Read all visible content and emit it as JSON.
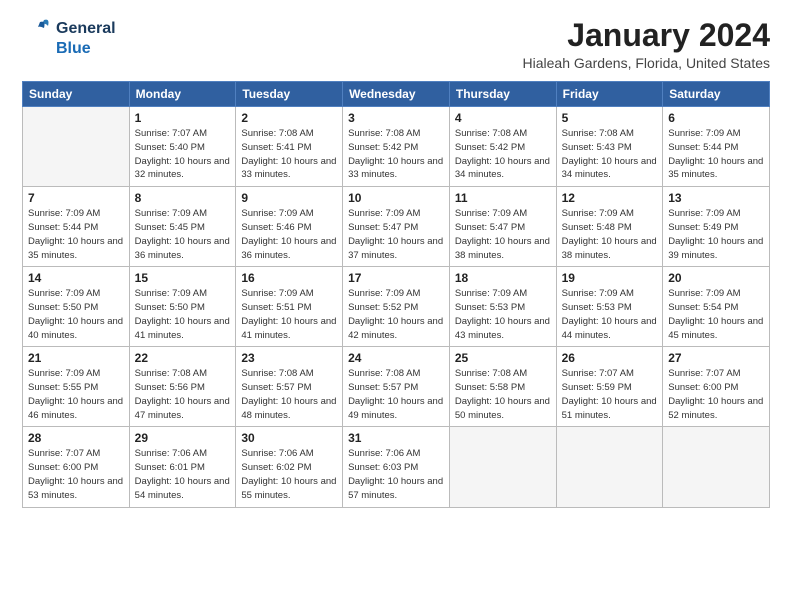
{
  "logo": {
    "line1": "General",
    "line2": "Blue"
  },
  "title": "January 2024",
  "subtitle": "Hialeah Gardens, Florida, United States",
  "days_of_week": [
    "Sunday",
    "Monday",
    "Tuesday",
    "Wednesday",
    "Thursday",
    "Friday",
    "Saturday"
  ],
  "weeks": [
    [
      {
        "num": "",
        "sunrise": "",
        "sunset": "",
        "daylight": ""
      },
      {
        "num": "1",
        "sunrise": "Sunrise: 7:07 AM",
        "sunset": "Sunset: 5:40 PM",
        "daylight": "Daylight: 10 hours and 32 minutes."
      },
      {
        "num": "2",
        "sunrise": "Sunrise: 7:08 AM",
        "sunset": "Sunset: 5:41 PM",
        "daylight": "Daylight: 10 hours and 33 minutes."
      },
      {
        "num": "3",
        "sunrise": "Sunrise: 7:08 AM",
        "sunset": "Sunset: 5:42 PM",
        "daylight": "Daylight: 10 hours and 33 minutes."
      },
      {
        "num": "4",
        "sunrise": "Sunrise: 7:08 AM",
        "sunset": "Sunset: 5:42 PM",
        "daylight": "Daylight: 10 hours and 34 minutes."
      },
      {
        "num": "5",
        "sunrise": "Sunrise: 7:08 AM",
        "sunset": "Sunset: 5:43 PM",
        "daylight": "Daylight: 10 hours and 34 minutes."
      },
      {
        "num": "6",
        "sunrise": "Sunrise: 7:09 AM",
        "sunset": "Sunset: 5:44 PM",
        "daylight": "Daylight: 10 hours and 35 minutes."
      }
    ],
    [
      {
        "num": "7",
        "sunrise": "Sunrise: 7:09 AM",
        "sunset": "Sunset: 5:44 PM",
        "daylight": "Daylight: 10 hours and 35 minutes."
      },
      {
        "num": "8",
        "sunrise": "Sunrise: 7:09 AM",
        "sunset": "Sunset: 5:45 PM",
        "daylight": "Daylight: 10 hours and 36 minutes."
      },
      {
        "num": "9",
        "sunrise": "Sunrise: 7:09 AM",
        "sunset": "Sunset: 5:46 PM",
        "daylight": "Daylight: 10 hours and 36 minutes."
      },
      {
        "num": "10",
        "sunrise": "Sunrise: 7:09 AM",
        "sunset": "Sunset: 5:47 PM",
        "daylight": "Daylight: 10 hours and 37 minutes."
      },
      {
        "num": "11",
        "sunrise": "Sunrise: 7:09 AM",
        "sunset": "Sunset: 5:47 PM",
        "daylight": "Daylight: 10 hours and 38 minutes."
      },
      {
        "num": "12",
        "sunrise": "Sunrise: 7:09 AM",
        "sunset": "Sunset: 5:48 PM",
        "daylight": "Daylight: 10 hours and 38 minutes."
      },
      {
        "num": "13",
        "sunrise": "Sunrise: 7:09 AM",
        "sunset": "Sunset: 5:49 PM",
        "daylight": "Daylight: 10 hours and 39 minutes."
      }
    ],
    [
      {
        "num": "14",
        "sunrise": "Sunrise: 7:09 AM",
        "sunset": "Sunset: 5:50 PM",
        "daylight": "Daylight: 10 hours and 40 minutes."
      },
      {
        "num": "15",
        "sunrise": "Sunrise: 7:09 AM",
        "sunset": "Sunset: 5:50 PM",
        "daylight": "Daylight: 10 hours and 41 minutes."
      },
      {
        "num": "16",
        "sunrise": "Sunrise: 7:09 AM",
        "sunset": "Sunset: 5:51 PM",
        "daylight": "Daylight: 10 hours and 41 minutes."
      },
      {
        "num": "17",
        "sunrise": "Sunrise: 7:09 AM",
        "sunset": "Sunset: 5:52 PM",
        "daylight": "Daylight: 10 hours and 42 minutes."
      },
      {
        "num": "18",
        "sunrise": "Sunrise: 7:09 AM",
        "sunset": "Sunset: 5:53 PM",
        "daylight": "Daylight: 10 hours and 43 minutes."
      },
      {
        "num": "19",
        "sunrise": "Sunrise: 7:09 AM",
        "sunset": "Sunset: 5:53 PM",
        "daylight": "Daylight: 10 hours and 44 minutes."
      },
      {
        "num": "20",
        "sunrise": "Sunrise: 7:09 AM",
        "sunset": "Sunset: 5:54 PM",
        "daylight": "Daylight: 10 hours and 45 minutes."
      }
    ],
    [
      {
        "num": "21",
        "sunrise": "Sunrise: 7:09 AM",
        "sunset": "Sunset: 5:55 PM",
        "daylight": "Daylight: 10 hours and 46 minutes."
      },
      {
        "num": "22",
        "sunrise": "Sunrise: 7:08 AM",
        "sunset": "Sunset: 5:56 PM",
        "daylight": "Daylight: 10 hours and 47 minutes."
      },
      {
        "num": "23",
        "sunrise": "Sunrise: 7:08 AM",
        "sunset": "Sunset: 5:57 PM",
        "daylight": "Daylight: 10 hours and 48 minutes."
      },
      {
        "num": "24",
        "sunrise": "Sunrise: 7:08 AM",
        "sunset": "Sunset: 5:57 PM",
        "daylight": "Daylight: 10 hours and 49 minutes."
      },
      {
        "num": "25",
        "sunrise": "Sunrise: 7:08 AM",
        "sunset": "Sunset: 5:58 PM",
        "daylight": "Daylight: 10 hours and 50 minutes."
      },
      {
        "num": "26",
        "sunrise": "Sunrise: 7:07 AM",
        "sunset": "Sunset: 5:59 PM",
        "daylight": "Daylight: 10 hours and 51 minutes."
      },
      {
        "num": "27",
        "sunrise": "Sunrise: 7:07 AM",
        "sunset": "Sunset: 6:00 PM",
        "daylight": "Daylight: 10 hours and 52 minutes."
      }
    ],
    [
      {
        "num": "28",
        "sunrise": "Sunrise: 7:07 AM",
        "sunset": "Sunset: 6:00 PM",
        "daylight": "Daylight: 10 hours and 53 minutes."
      },
      {
        "num": "29",
        "sunrise": "Sunrise: 7:06 AM",
        "sunset": "Sunset: 6:01 PM",
        "daylight": "Daylight: 10 hours and 54 minutes."
      },
      {
        "num": "30",
        "sunrise": "Sunrise: 7:06 AM",
        "sunset": "Sunset: 6:02 PM",
        "daylight": "Daylight: 10 hours and 55 minutes."
      },
      {
        "num": "31",
        "sunrise": "Sunrise: 7:06 AM",
        "sunset": "Sunset: 6:03 PM",
        "daylight": "Daylight: 10 hours and 57 minutes."
      },
      {
        "num": "",
        "sunrise": "",
        "sunset": "",
        "daylight": ""
      },
      {
        "num": "",
        "sunrise": "",
        "sunset": "",
        "daylight": ""
      },
      {
        "num": "",
        "sunrise": "",
        "sunset": "",
        "daylight": ""
      }
    ]
  ]
}
